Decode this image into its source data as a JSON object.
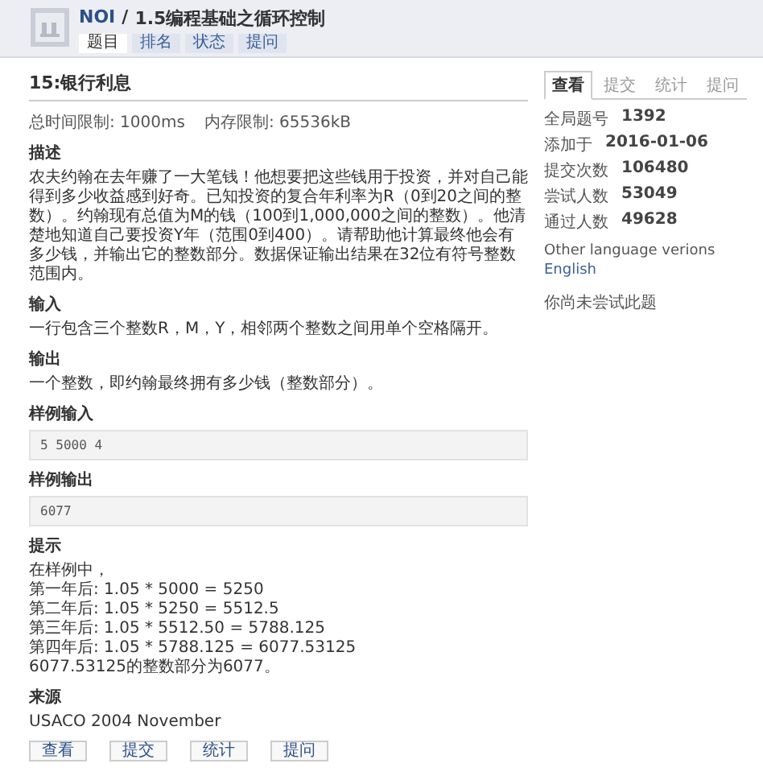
{
  "header": {
    "site": "NOI",
    "separator": "/",
    "title": "1.5编程基础之循环控制",
    "tabs": [
      {
        "label": "题目",
        "selected": true
      },
      {
        "label": "排名",
        "selected": false
      },
      {
        "label": "状态",
        "selected": false
      },
      {
        "label": "提问",
        "selected": false
      }
    ]
  },
  "problem": {
    "title": "15:银行利息",
    "limits": [
      "总时间限制: 1000ms",
      "内存限制: 65536kB"
    ],
    "sections": [
      {
        "heading": "描述",
        "kind": "text",
        "lines": [
          "农夫约翰在去年赚了一大笔钱！他想要把这些钱用于投资，并对自己能得到多少收益感到好奇。已知投资的复合年利率为R（0到20之间的整数）。约翰现有总值为M的钱（100到1,000,000之间的整数）。他清楚地知道自己要投资Y年（范围0到400）。请帮助他计算最终他会有多少钱，并输出它的整数部分。数据保证输出结果在32位有符号整数范围内。"
        ]
      },
      {
        "heading": "输入",
        "kind": "text",
        "lines": [
          "一行包含三个整数R，M，Y，相邻两个整数之间用单个空格隔开。"
        ]
      },
      {
        "heading": "输出",
        "kind": "text",
        "lines": [
          "一个整数，即约翰最终拥有多少钱（整数部分）。"
        ]
      },
      {
        "heading": "样例输入",
        "kind": "sample",
        "lines": [
          "5 5000 4"
        ]
      },
      {
        "heading": "样例输出",
        "kind": "sample",
        "lines": [
          "6077"
        ]
      },
      {
        "heading": "提示",
        "kind": "text",
        "lines": [
          "在样例中，",
          "第一年后: 1.05 * 5000 = 5250",
          "第二年后: 1.05 * 5250 = 5512.5",
          "第三年后: 1.05 * 5512.50 = 5788.125",
          "第四年后: 1.05 * 5788.125 = 6077.53125",
          "6077.53125的整数部分为6077。"
        ]
      },
      {
        "heading": "来源",
        "kind": "text",
        "lines": [
          "USACO 2004 November"
        ]
      }
    ],
    "bottom_links": [
      "查看",
      "提交",
      "统计",
      "提问"
    ]
  },
  "side": {
    "tabs": [
      {
        "label": "查看",
        "selected": true
      },
      {
        "label": "提交",
        "selected": false
      },
      {
        "label": "统计",
        "selected": false
      },
      {
        "label": "提问",
        "selected": false
      }
    ],
    "stats": [
      {
        "label": "全局题号",
        "value": "1392"
      },
      {
        "label": "添加于",
        "value": "2016-01-06"
      },
      {
        "label": "提交次数",
        "value": "106480"
      },
      {
        "label": "尝试人数",
        "value": "53049"
      },
      {
        "label": "通过人数",
        "value": "49628"
      }
    ],
    "other_languages_label": "Other language verions",
    "languages": [
      "English"
    ],
    "note": "你尚未尝试此题"
  }
}
